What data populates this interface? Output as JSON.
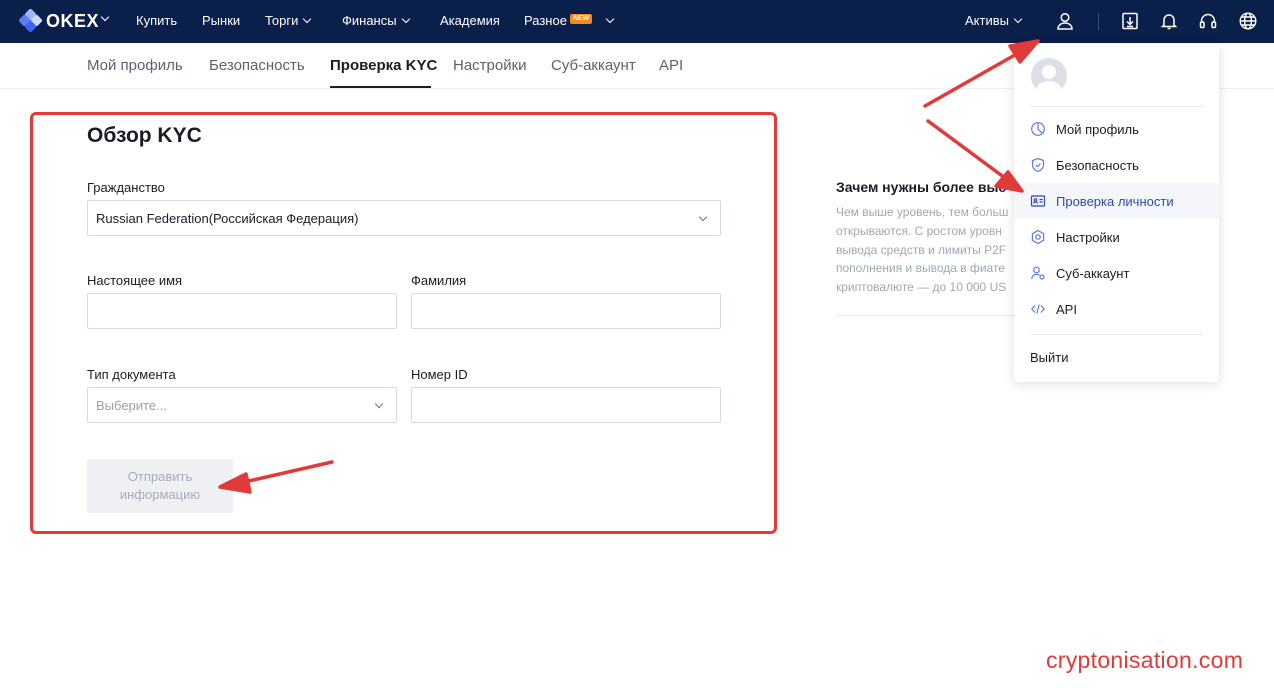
{
  "topbar": {
    "logo_text": "OKEX",
    "nav": [
      {
        "label": "Купить",
        "has_chevron": false
      },
      {
        "label": "Рынки",
        "has_chevron": false
      },
      {
        "label": "Торги",
        "has_chevron": true
      },
      {
        "label": "Финансы",
        "has_chevron": true
      },
      {
        "label": "Академия",
        "has_chevron": false
      },
      {
        "label": "Разное",
        "has_chevron": true
      }
    ],
    "new_badge": "NEW",
    "assets_label": "Активы",
    "icons": [
      "user-icon",
      "download-icon",
      "bell-icon",
      "headset-icon",
      "globe-icon"
    ]
  },
  "subnav": {
    "tabs": [
      {
        "label": "Мой профиль"
      },
      {
        "label": "Безопасность"
      },
      {
        "label": "Проверка KYC",
        "active": true
      },
      {
        "label": "Настройки"
      },
      {
        "label": "Суб-аккаунт"
      },
      {
        "label": "API"
      }
    ]
  },
  "form": {
    "title": "Обзор KYC",
    "citizenship_label": "Гражданство",
    "citizenship_value": "Russian Federation(Российская Федерация)",
    "first_name_label": "Настоящее имя",
    "first_name_value": "",
    "last_name_label": "Фамилия",
    "last_name_value": "",
    "doc_type_label": "Тип документа",
    "doc_type_placeholder": "Выберите...",
    "id_number_label": "Номер ID",
    "id_number_value": "",
    "submit_line1": "Отправить",
    "submit_line2": "информацию"
  },
  "side_info": {
    "title": "Зачем нужны более выс",
    "lines": [
      "Чем выше уровень, тем больш",
      "открываются. С ростом уровн",
      "вывода средств и лимиты P2F",
      "пополнения и вывода в фиате",
      "криптовалюте — до 10 000 US"
    ]
  },
  "profile_menu": {
    "items": [
      {
        "label": "Мой профиль",
        "icon": "profile-pie-icon"
      },
      {
        "label": "Безопасность",
        "icon": "shield-icon"
      },
      {
        "label": "Проверка личности",
        "icon": "id-card-icon",
        "active": true
      },
      {
        "label": "Настройки",
        "icon": "gear-icon"
      },
      {
        "label": "Суб-аккаунт",
        "icon": "subaccount-icon"
      },
      {
        "label": "API",
        "icon": "code-icon"
      }
    ],
    "logout_label": "Выйти"
  },
  "watermark": "cryptonisation.com",
  "colors": {
    "topbar_bg": "#0b1f4b",
    "annotation_red": "#e03b3b",
    "active_menu_text": "#2a4ea8"
  }
}
